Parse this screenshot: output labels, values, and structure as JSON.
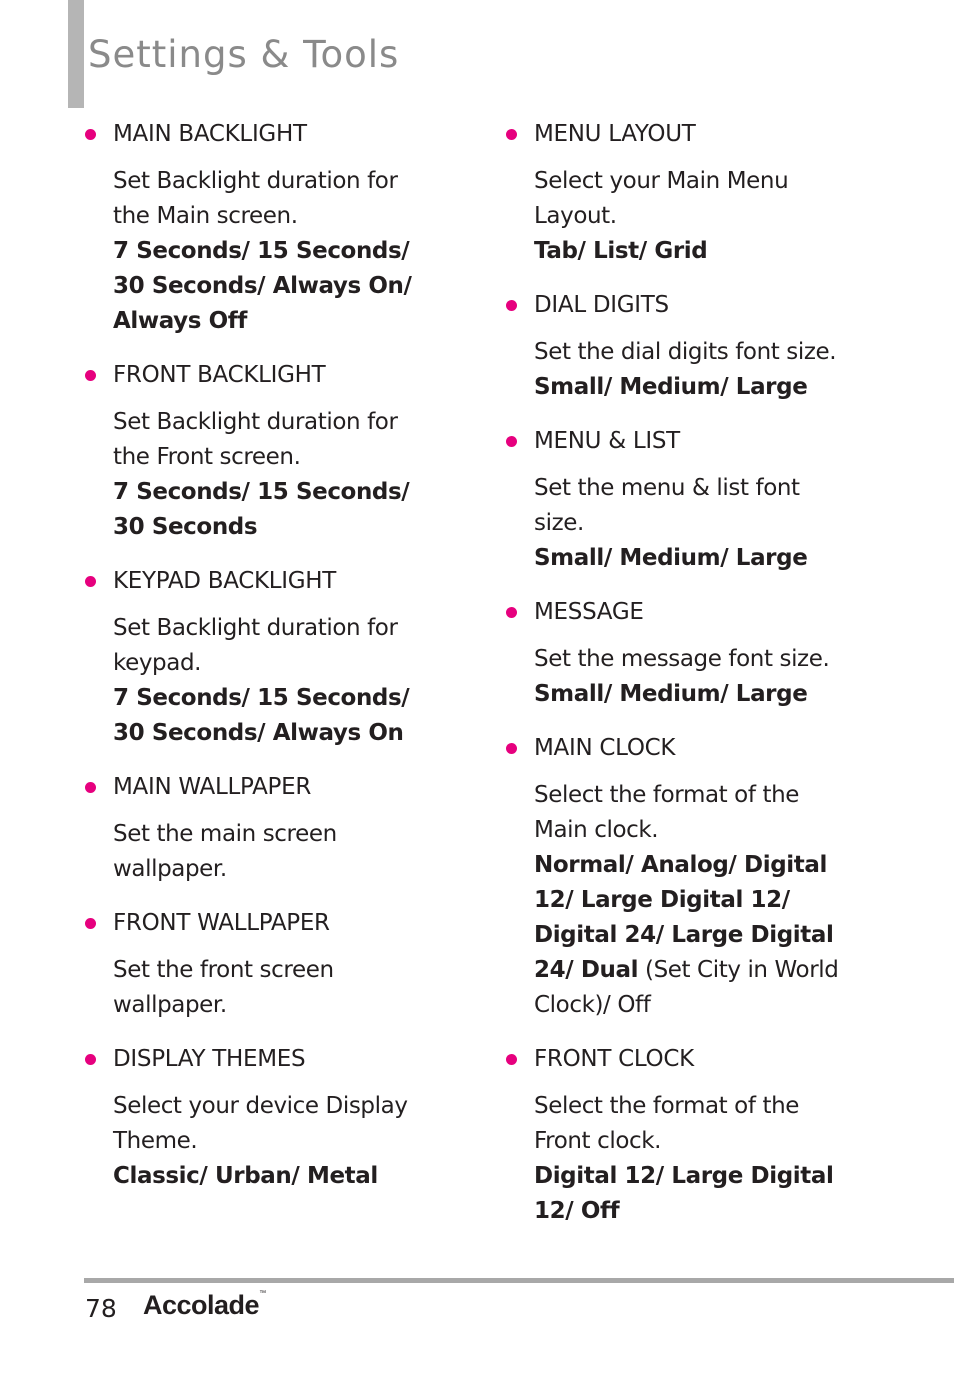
{
  "header": {
    "title": "Settings & Tools"
  },
  "left_column": [
    {
      "heading": "MAIN BACKLIGHT",
      "description": "Set Backlight duration for the Main screen.",
      "options": "7 Seconds/ 15 Seconds/ 30 Seconds/ Always On/ Always Off"
    },
    {
      "heading": "FRONT BACKLIGHT",
      "description": "Set Backlight duration for the Front screen.",
      "options": "7 Seconds/ 15 Seconds/ 30 Seconds"
    },
    {
      "heading": "KEYPAD BACKLIGHT",
      "description": "Set Backlight duration for keypad.",
      "options": "7 Seconds/ 15 Seconds/ 30 Seconds/ Always On"
    },
    {
      "heading": "MAIN WALLPAPER",
      "description": "Set the main screen wallpaper."
    },
    {
      "heading": "FRONT WALLPAPER",
      "description": "Set the front screen wallpaper."
    },
    {
      "heading": "DISPLAY THEMES",
      "description": "Select your device Display Theme.",
      "options": "Classic/ Urban/ Metal"
    }
  ],
  "right_column": [
    {
      "heading": "MENU LAYOUT",
      "description": "Select your Main Menu Layout.",
      "options": "Tab/ List/ Grid"
    },
    {
      "heading": "DIAL DIGITS",
      "description": "Set the dial digits font size.",
      "options": "Small/ Medium/ Large"
    },
    {
      "heading": "MENU & LIST",
      "description": "Set the menu & list font size.",
      "options": "Small/ Medium/ Large"
    },
    {
      "heading": "MESSAGE",
      "description": "Set the message font size.",
      "options": "Small/ Medium/ Large"
    },
    {
      "heading": "MAIN CLOCK",
      "description": "Select the format of the Main clock.",
      "options": "Normal/ Analog/ Digital 12/ Large Digital 12/ Digital 24/ Large Digital 24/ Dual",
      "options_tail": " (Set City in World Clock)/ Off"
    },
    {
      "heading": "FRONT CLOCK",
      "description": "Select the format of the Front clock.",
      "options": "Digital 12/ Large Digital 12/ Off"
    }
  ],
  "footer": {
    "page_number": "78",
    "brand": "Accolade",
    "trademark": "™"
  },
  "colors": {
    "bullet": "#e6007e",
    "title": "#8a8a8a",
    "rule": "#a8a8a8"
  }
}
